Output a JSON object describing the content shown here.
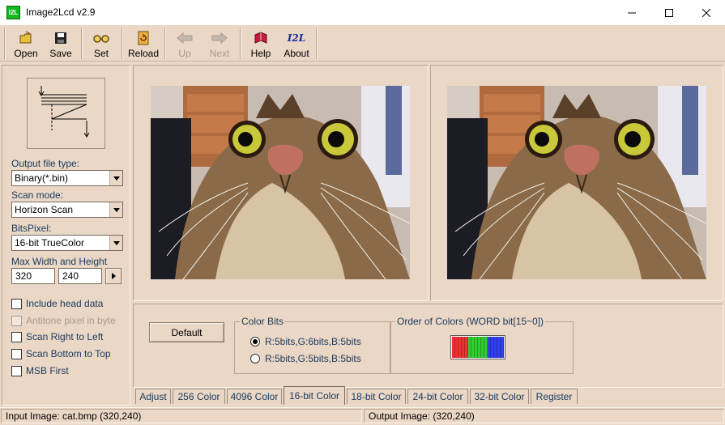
{
  "window": {
    "app_icon_text": "I2L",
    "title": "Image2Lcd v2.9"
  },
  "toolbar": {
    "open": "Open",
    "save": "Save",
    "set": "Set",
    "reload": "Reload",
    "up": "Up",
    "next": "Next",
    "help": "Help",
    "about": "About",
    "about_logo_text": "I2L"
  },
  "left": {
    "output_type_label": "Output file type:",
    "output_type_value": "Binary(*.bin)",
    "scan_mode_label": "Scan mode:",
    "scan_mode_value": "Horizon Scan",
    "bits_pixel_label": "BitsPixel:",
    "bits_pixel_value": "16-bit TrueColor",
    "max_size_label": "Max Width and Height",
    "max_width": "320",
    "max_height": "240",
    "checkboxes": [
      {
        "label": "Include head data",
        "checked": false,
        "enabled": true
      },
      {
        "label": "Antitone pixel in byte",
        "checked": false,
        "enabled": false
      },
      {
        "label": "Scan Right to Left",
        "checked": false,
        "enabled": true
      },
      {
        "label": "Scan Bottom to Top",
        "checked": false,
        "enabled": true
      },
      {
        "label": "MSB First",
        "checked": false,
        "enabled": true
      }
    ]
  },
  "settings": {
    "default_button": "Default",
    "color_bits_title": "Color Bits",
    "radio_options": [
      {
        "label": "R:5bits,G:6bits,B:5bits",
        "selected": true
      },
      {
        "label": "R:5bits,G:5bits,B:5bits",
        "selected": false
      }
    ],
    "order_title": "Order of Colors (WORD bit[15~0])",
    "order_colors": [
      "#ee3030",
      "#30cc30",
      "#3040ee"
    ]
  },
  "tabs": [
    {
      "label": "Adjust",
      "active": false
    },
    {
      "label": "256 Color",
      "active": false
    },
    {
      "label": "4096 Color",
      "active": false
    },
    {
      "label": "16-bit Color",
      "active": true
    },
    {
      "label": "18-bit Color",
      "active": false
    },
    {
      "label": "24-bit Color",
      "active": false
    },
    {
      "label": "32-bit Color",
      "active": false
    },
    {
      "label": "Register",
      "active": false
    }
  ],
  "status": {
    "input": "Input Image: cat.bmp (320,240)",
    "output": "Output Image: (320,240)"
  }
}
